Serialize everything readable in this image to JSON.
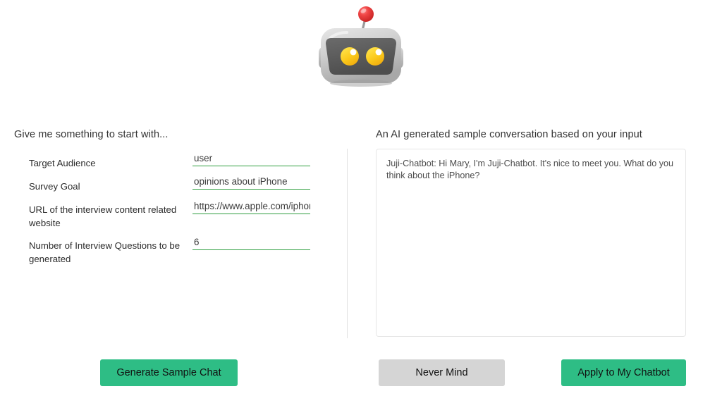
{
  "mascot": {
    "icon": "robot-head-icon",
    "head_color": "#c9c9c9",
    "face_color": "#5a5a5a",
    "eye_color": "#ffd21e",
    "antenna_color": "#e23b3b"
  },
  "left_panel": {
    "heading": "Give me something to start with...",
    "fields": [
      {
        "name": "target-audience",
        "label": "Target Audience",
        "value": "user",
        "placeholder": "",
        "multiline_label": false
      },
      {
        "name": "survey-goal",
        "label": "Survey Goal",
        "value": "opinions about iPhone",
        "placeholder": "",
        "multiline_label": false
      },
      {
        "name": "interview-url",
        "label": "URL of the interview content related website",
        "value": "https://www.apple.com/iphone",
        "placeholder": "",
        "multiline_label": true
      },
      {
        "name": "question-count",
        "label": "Number of Interview Questions to be generated",
        "value": "6",
        "placeholder": "",
        "multiline_label": true
      }
    ]
  },
  "right_panel": {
    "heading": "An AI generated sample conversation based on your input",
    "sample_conversation": "Juji-Chatbot: Hi Mary, I'm Juji-Chatbot. It's nice to meet you. What do you think about the iPhone?",
    "sample_placeholder": ""
  },
  "buttons": {
    "generate": "Generate Sample Chat",
    "never_mind": "Never Mind",
    "apply": "Apply to My Chatbot"
  },
  "colors": {
    "accent_green": "#2ebd85",
    "underline_green": "#2f9e3f",
    "neutral_grey": "#d5d5d5"
  }
}
